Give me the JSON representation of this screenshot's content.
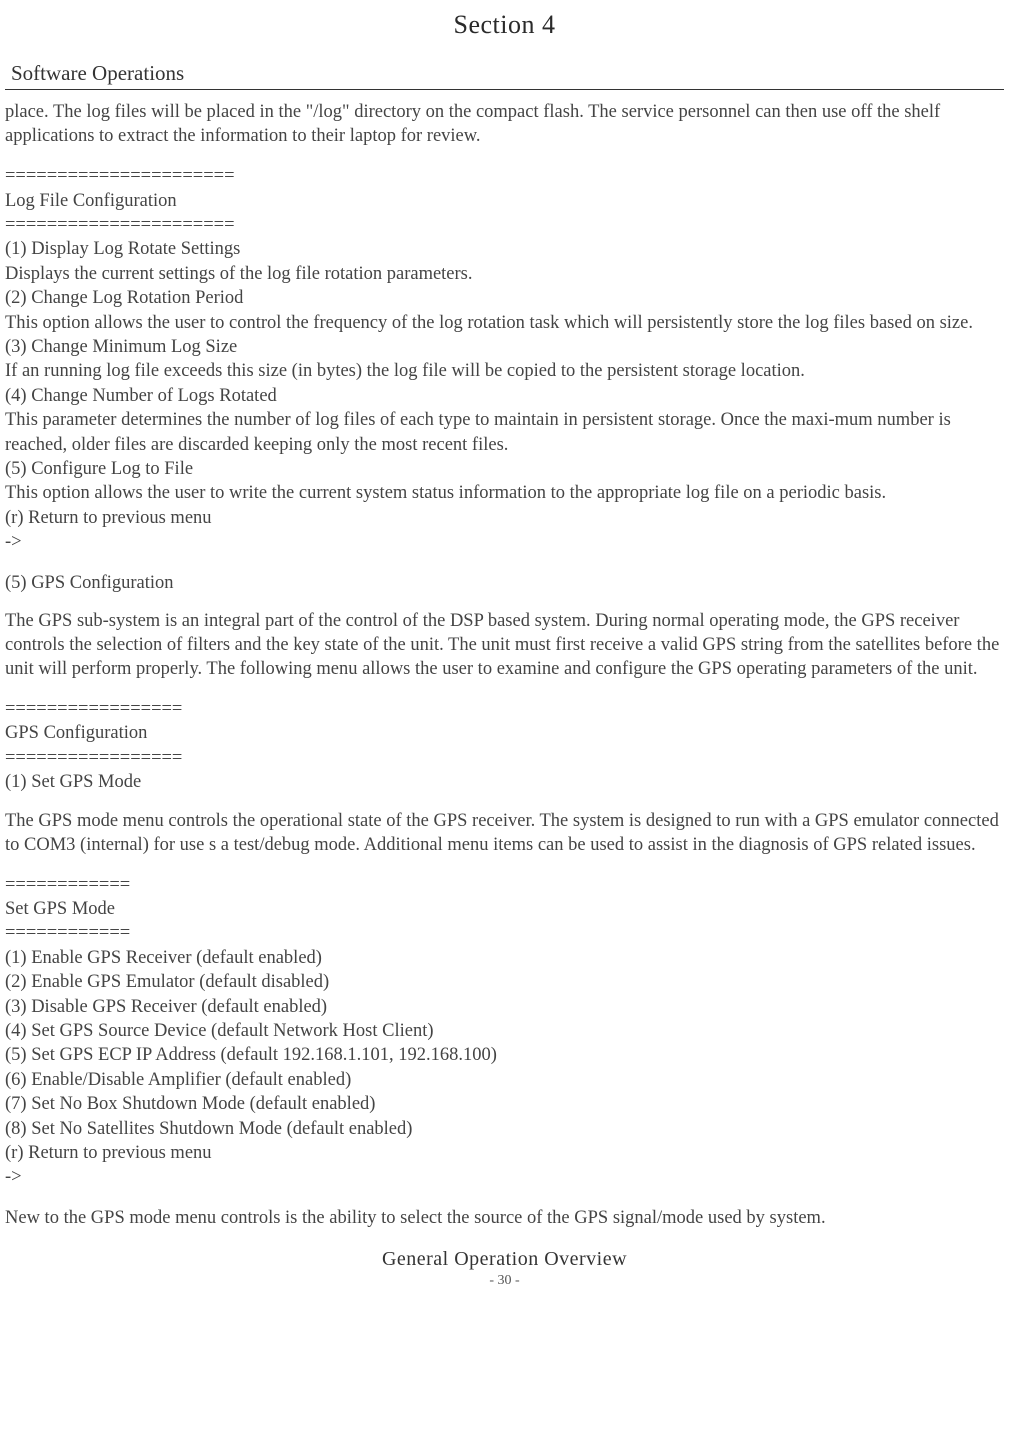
{
  "header": {
    "section": "Section  4",
    "subtitle": "Software Operations"
  },
  "intro_para": "place. The  log files will be  placed in the  \"/log\" directory on  the  compact flash.  The  service personnel can  then  use off the  shelf applications to extract  the  information to their laptop for review.",
  "log_config": {
    "divider": "======================",
    "title": "Log File Configuration",
    "items": [
      "(1) Display  Log Rotate Settings",
      "Displays  the  current  settings of the  log file rotation parameters.",
      "(2) Change Log Rotation  Period",
      "This option  allows  the  user  to control  the  frequency of the  log rotation  task  which  will persistently store  the  log files based on  size.",
      "(3) Change Minimum Log Size",
      "If an  running  log file exceeds this size  (in bytes)  the  log file will be  copied to the  persistent storage location.",
      "(4) Change Number  of Logs  Rotated",
      "This parameter determines the  number of log files of each type  to  maintain in persistent storage. Once  the  maxi-mum  number is reached, older  files are  discarded keeping only the  most  recent files.",
      "(5) Configure Log to File",
      "This option  allows  the  user  to write the  current  system status information  to the  appropriate log file on  a  periodic basis.",
      "(r) Return  to previous menu",
      "->"
    ]
  },
  "gps_section": {
    "heading": "(5) GPS  Configuration",
    "para": "The  GPS  sub-system is an  integral  part  of the  control  of the  DSP  based system. During normal  operating mode,  the GPS  receiver controls  the  selection of filters and  the  key  state of the  unit. The  unit must  first receive a  valid GPS string  from the  satellites before  the  unit will perform  properly.  The  following menu  allows the  user to examine and configure the  GPS  operating parameters of the  unit."
  },
  "gps_config": {
    "divider": "=================",
    "title": "GPS  Configuration",
    "item1": "(1) Set  GPS  Mode",
    "para": "The  GPS  mode  menu  controls  the  operational state  of the  GPS  receiver. The  system  is designed  to run with a GPS emulator connected  to COM3  (internal)  for use  s  a  test/debug mode.  Additional menu  items  can  be  used to  assist  in the  diagnosis of GPS  related issues."
  },
  "set_gps_mode": {
    "divider": "============",
    "title": "Set  GPS  Mode",
    "items": [
      "(1) Enable  GPS  Receiver (default  enabled)",
      "(2) Enable  GPS  Emulator  (default  disabled)",
      "(3) Disable  GPS  Receiver (default  enabled)",
      "(4) Set  GPS  Source Device  (default  Network  Host  Client)",
      "(5) Set  GPS  ECP  IP Address (default 192.168.1.101, 192.168.100)",
      "(6) Enable/Disable Amplifier (default enabled)",
      "(7) Set  No Box Shutdown Mode  (default  enabled)",
      "(8) Set  No Satellites Shutdown Mode  (default  enabled)",
      "(r) Return  to previous menu",
      "->"
    ]
  },
  "closing_para": "New  to the  GPS  mode  menu  controls  is the  ability to  select the  source of the  GPS  signal/mode used  by system.",
  "footer": {
    "title": "General  Operation  Overview",
    "page": "- 30 -"
  }
}
